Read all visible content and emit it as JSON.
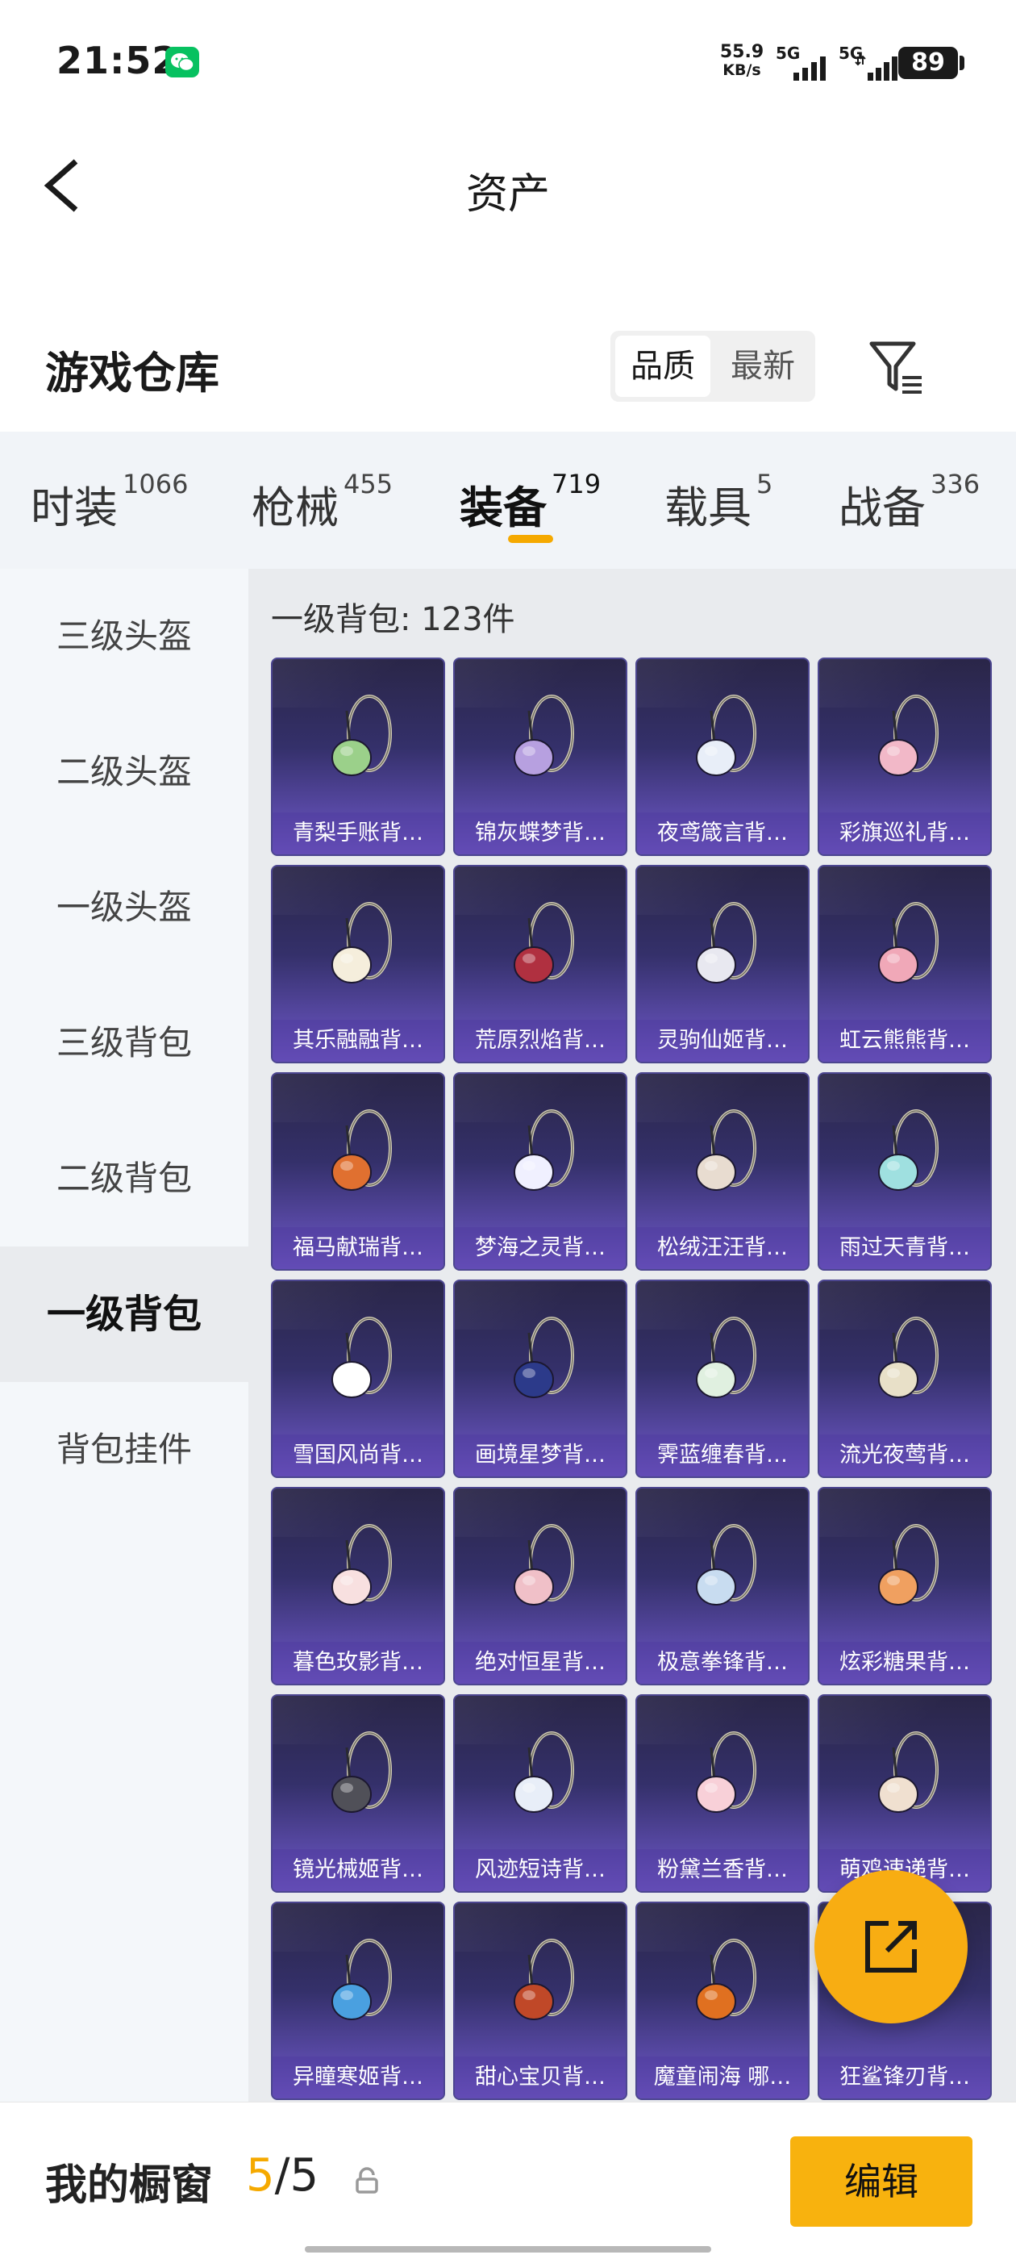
{
  "status_bar": {
    "time": "21:52",
    "net_speed_value": "55.9",
    "net_speed_unit": "KB/s",
    "signal_1": "5G",
    "signal_2": "5G",
    "battery": "89"
  },
  "nav": {
    "title": "资产"
  },
  "warehouse": {
    "title": "游戏仓库",
    "sort_options": [
      "品质",
      "最新"
    ],
    "sort_selected": "品质"
  },
  "tabs": [
    {
      "label": "时装",
      "count": "1066"
    },
    {
      "label": "枪械",
      "count": "455"
    },
    {
      "label": "装备",
      "count": "719",
      "active": true
    },
    {
      "label": "载具",
      "count": "5"
    },
    {
      "label": "战备",
      "count": "336"
    }
  ],
  "sidebar": {
    "items": [
      "三级头盔",
      "二级头盔",
      "一级头盔",
      "三级背包",
      "二级背包",
      "一级背包",
      "背包挂件"
    ],
    "active": "一级背包"
  },
  "content": {
    "section_label": "一级背包: 123件",
    "items": [
      {
        "name": "青梨手账背…"
      },
      {
        "name": "锦灰蝶梦背…"
      },
      {
        "name": "夜鸢箴言背…"
      },
      {
        "name": "彩旗巡礼背…"
      },
      {
        "name": "其乐融融背…"
      },
      {
        "name": "荒原烈焰背…"
      },
      {
        "name": "灵驹仙姬背…"
      },
      {
        "name": "虹云熊熊背…"
      },
      {
        "name": "福马献瑞背…"
      },
      {
        "name": "梦海之灵背…"
      },
      {
        "name": "松绒汪汪背…"
      },
      {
        "name": "雨过天青背…"
      },
      {
        "name": "雪国风尚背…"
      },
      {
        "name": "画境星梦背…"
      },
      {
        "name": "霁蓝缠春背…"
      },
      {
        "name": "流光夜莺背…"
      },
      {
        "name": "暮色玫影背…"
      },
      {
        "name": "绝对恒星背…"
      },
      {
        "name": "极意拳锋背…"
      },
      {
        "name": "炫彩糖果背…"
      },
      {
        "name": "镜光械姬背…"
      },
      {
        "name": "风迹短诗背…"
      },
      {
        "name": "粉黛兰香背…"
      },
      {
        "name": "萌鸡速递背…"
      },
      {
        "name": "异瞳寒姬背…"
      },
      {
        "name": "甜心宝贝背…"
      },
      {
        "name": "魔童闹海 哪…"
      },
      {
        "name": "狂鲨锋刃背…"
      }
    ]
  },
  "bottom_bar": {
    "window_label": "我的橱窗",
    "window_current": "5",
    "window_total": "/5",
    "edit_label": "编辑"
  },
  "colors": {
    "accent": "#f8b20e",
    "card_top": "#2a2648",
    "card_bottom": "#7a5fd0",
    "item_accents": [
      "#9bd08a",
      "#b7a0e0",
      "#e8eef8",
      "#f2b8c8",
      "#f5eedc",
      "#b03040",
      "#e8e8f0",
      "#f0a8b8",
      "#e07030",
      "#f0f0ff",
      "#e8dcd0",
      "#9fe0e0",
      "#ffffff",
      "#2c3a8a",
      "#e0f0e0",
      "#e8e0c8",
      "#f8e0e0",
      "#f0c0c8",
      "#c8dcf0",
      "#f0a060",
      "#505058",
      "#e8eef8",
      "#f8d0d8",
      "#f0e0d0",
      "#4aa0e0",
      "#c04828",
      "#e07020",
      "#f0a000"
    ]
  }
}
